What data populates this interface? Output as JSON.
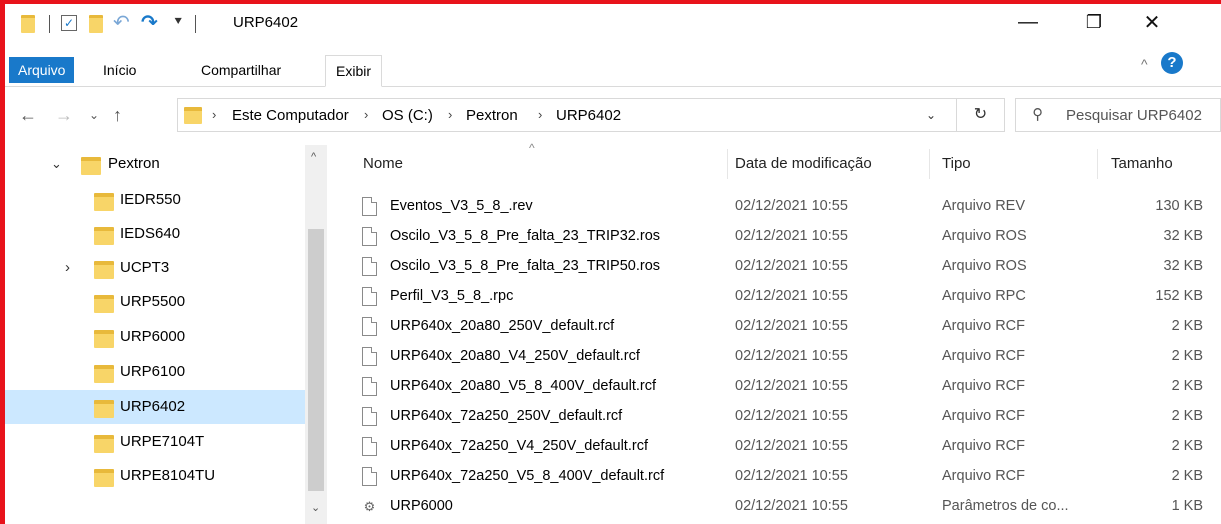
{
  "window": {
    "title": "URP6402",
    "minimize": "—",
    "restore": "❐",
    "close": "✕"
  },
  "ribbon": {
    "tabs": [
      "Arquivo",
      "Início",
      "Compartilhar",
      "Exibir"
    ],
    "help": "?"
  },
  "address": {
    "crumbs": [
      "Este Computador",
      "OS (C:)",
      "Pextron",
      "URP6402"
    ],
    "search_placeholder": "Pesquisar URP6402"
  },
  "nav": {
    "items": [
      {
        "label": "Pextron",
        "expanded": true,
        "selected": false
      },
      {
        "label": "IEDR550",
        "selected": false
      },
      {
        "label": "IEDS640",
        "selected": false
      },
      {
        "label": "UCPT3",
        "collapsed": true,
        "selected": false
      },
      {
        "label": "URP5500",
        "selected": false
      },
      {
        "label": "URP6000",
        "selected": false
      },
      {
        "label": "URP6100",
        "selected": false
      },
      {
        "label": "URP6402",
        "selected": true
      },
      {
        "label": "URPE7104T",
        "selected": false
      },
      {
        "label": "URPE8104TU",
        "selected": false
      }
    ]
  },
  "columns": {
    "name": "Nome",
    "date": "Data de modificação",
    "type": "Tipo",
    "size": "Tamanho"
  },
  "files": [
    {
      "name": "Eventos_V3_5_8_.rev",
      "date": "02/12/2021 10:55",
      "type": "Arquivo REV",
      "size": "130 KB",
      "icon": "file-icon"
    },
    {
      "name": "Oscilo_V3_5_8_Pre_falta_23_TRIP32.ros",
      "date": "02/12/2021 10:55",
      "type": "Arquivo ROS",
      "size": "32 KB",
      "icon": "file-icon"
    },
    {
      "name": "Oscilo_V3_5_8_Pre_falta_23_TRIP50.ros",
      "date": "02/12/2021 10:55",
      "type": "Arquivo ROS",
      "size": "32 KB",
      "icon": "file-icon"
    },
    {
      "name": "Perfil_V3_5_8_.rpc",
      "date": "02/12/2021 10:55",
      "type": "Arquivo RPC",
      "size": "152 KB",
      "icon": "file-icon"
    },
    {
      "name": "URP640x_20a80_250V_default.rcf",
      "date": "02/12/2021 10:55",
      "type": "Arquivo RCF",
      "size": "2 KB",
      "icon": "file-icon"
    },
    {
      "name": "URP640x_20a80_V4_250V_default.rcf",
      "date": "02/12/2021 10:55",
      "type": "Arquivo RCF",
      "size": "2 KB",
      "icon": "file-icon"
    },
    {
      "name": "URP640x_20a80_V5_8_400V_default.rcf",
      "date": "02/12/2021 10:55",
      "type": "Arquivo RCF",
      "size": "2 KB",
      "icon": "file-icon"
    },
    {
      "name": "URP640x_72a250_250V_default.rcf",
      "date": "02/12/2021 10:55",
      "type": "Arquivo RCF",
      "size": "2 KB",
      "icon": "file-icon"
    },
    {
      "name": "URP640x_72a250_V4_250V_default.rcf",
      "date": "02/12/2021 10:55",
      "type": "Arquivo RCF",
      "size": "2 KB",
      "icon": "file-icon"
    },
    {
      "name": "URP640x_72a250_V5_8_400V_default.rcf",
      "date": "02/12/2021 10:55",
      "type": "Arquivo RCF",
      "size": "2 KB",
      "icon": "file-icon"
    },
    {
      "name": "URP6000",
      "date": "02/12/2021 10:55",
      "type": "Parâmetros de co...",
      "size": "1 KB",
      "icon": "settings-file-icon"
    }
  ],
  "colors": {
    "accent": "#1979ca",
    "selection": "#cce8ff",
    "frame": "#e8131b",
    "folder": "#f8d568"
  }
}
